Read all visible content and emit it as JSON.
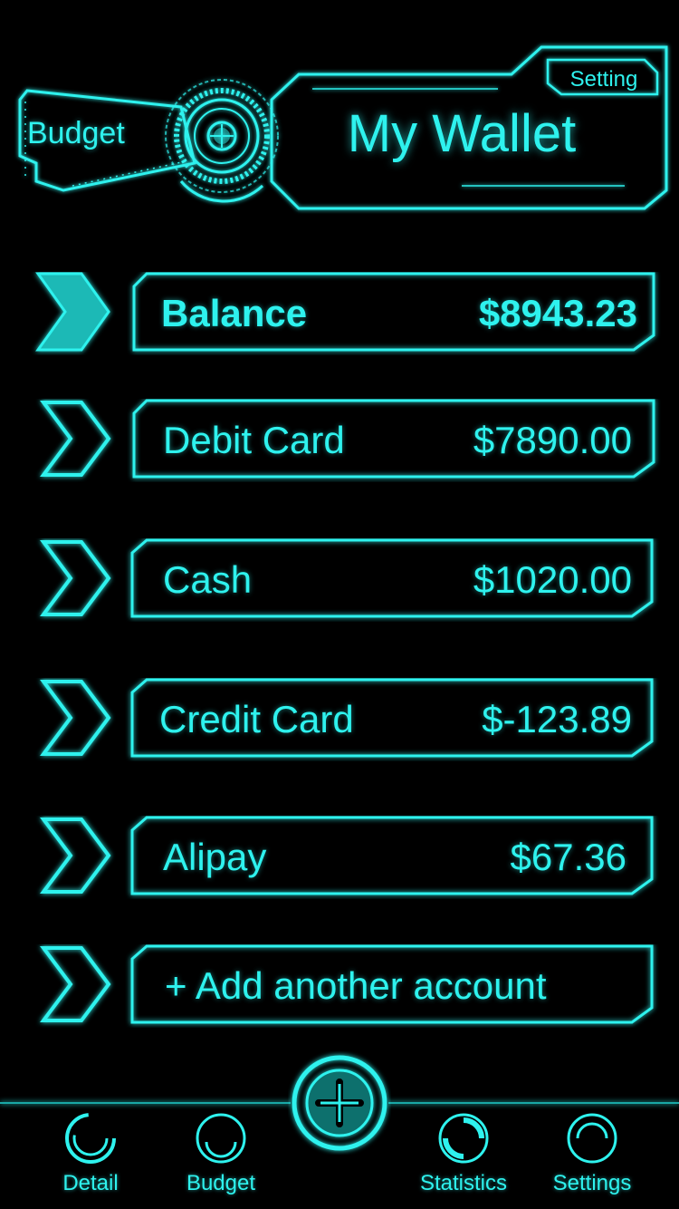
{
  "header": {
    "budget_tab": "Budget",
    "title": "My Wallet",
    "setting_button": "Setting"
  },
  "accounts": [
    {
      "label": "Balance",
      "amount": "$8943.23",
      "emphasis": true
    },
    {
      "label": "Debit Card",
      "amount": "$7890.00"
    },
    {
      "label": "Cash",
      "amount": "$1020.00"
    },
    {
      "label": "Credit Card",
      "amount": "$-123.89"
    },
    {
      "label": "Alipay",
      "amount": "$67.36"
    },
    {
      "label": "+ Add another account",
      "amount": ""
    }
  ],
  "nav": {
    "items": [
      {
        "label": "Detail",
        "icon": "detail-ring-icon"
      },
      {
        "label": "Budget",
        "icon": "budget-ring-icon"
      },
      {
        "label": "Statistics",
        "icon": "statistics-ring-icon"
      },
      {
        "label": "Settings",
        "icon": "settings-ring-icon"
      }
    ],
    "add_icon": "plus-icon"
  },
  "colors": {
    "accent": "#2ef2ee",
    "background": "#000000",
    "dim_accent": "#0f6f6d"
  }
}
